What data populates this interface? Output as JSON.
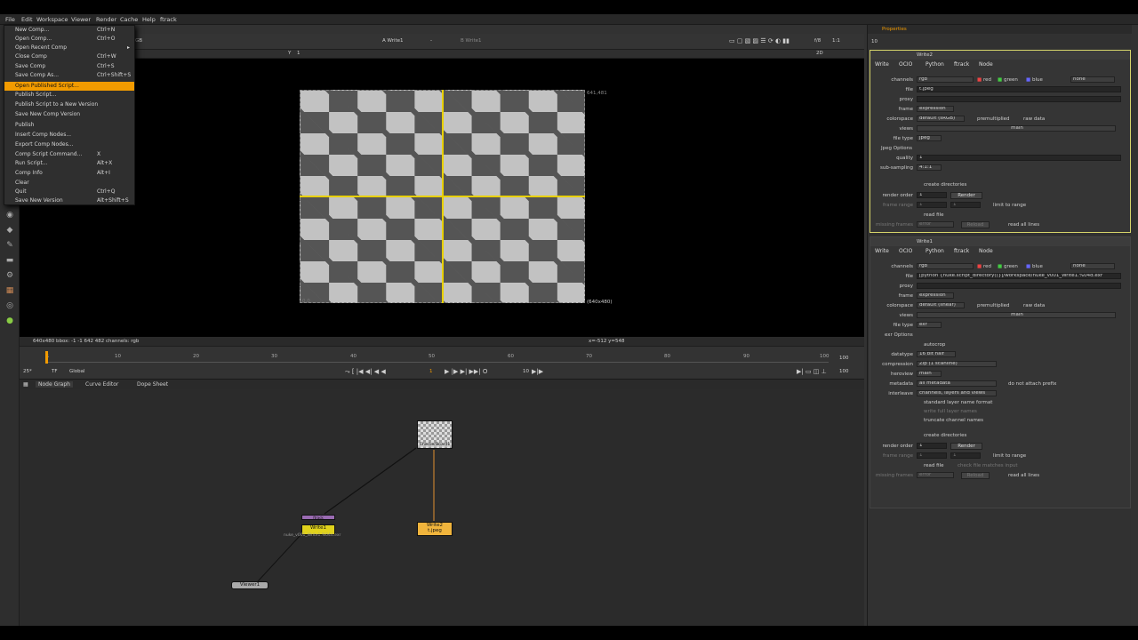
{
  "menubar": [
    "File",
    "Edit",
    "Workspace",
    "Viewer",
    "Render",
    "Cache",
    "Help",
    "ftrack"
  ],
  "file_menu": [
    {
      "label": "New Comp...",
      "shortcut": "Ctrl+N"
    },
    {
      "label": "Open Comp...",
      "shortcut": "Ctrl+O"
    },
    {
      "label": "Open Recent Comp",
      "shortcut": "▸"
    },
    {
      "label": "Close Comp",
      "shortcut": "Ctrl+W"
    },
    {
      "label": "Save Comp",
      "shortcut": "Ctrl+S"
    },
    {
      "label": "Save Comp As...",
      "shortcut": "Ctrl+Shift+S"
    },
    {
      "label": "Open Published Script...",
      "shortcut": ""
    },
    {
      "label": "Publish Script...",
      "shortcut": ""
    },
    {
      "label": "Publish Script to a New Version",
      "shortcut": ""
    },
    {
      "label": "Save New Comp Version",
      "shortcut": ""
    },
    {
      "label": "Publish",
      "shortcut": ""
    },
    {
      "label": "Insert Comp Nodes...",
      "shortcut": ""
    },
    {
      "label": "Export Comp Nodes...",
      "shortcut": ""
    },
    {
      "label": "Comp Script Command...",
      "shortcut": "X"
    },
    {
      "label": "Run Script...",
      "shortcut": "Alt+X"
    },
    {
      "label": "Comp Info",
      "shortcut": "Alt+I"
    },
    {
      "label": "Clear",
      "shortcut": ""
    },
    {
      "label": "Quit",
      "shortcut": "Ctrl+Q"
    },
    {
      "label": "Save New Version",
      "shortcut": "Alt+Shift+S"
    }
  ],
  "viewer": {
    "channel_label": "GB",
    "input_a": "A  Write1",
    "input_b": "B  Write1",
    "dash": "-",
    "view_mode": "2D",
    "zoom": "1:1",
    "gain_label": "f/8",
    "y_label": "Y",
    "y_value": "1",
    "res_top": "641,481",
    "res_bottom": "(640x480)",
    "corner_label": "0,0",
    "info_left": "640x480  bbox: -1 -1 642 482 channels: rgb",
    "info_right": "x=-512 y=548"
  },
  "timeline": {
    "ticks": [
      "1",
      "10",
      "20",
      "30",
      "40",
      "50",
      "60",
      "70",
      "80",
      "90",
      "100"
    ],
    "fps": "25*",
    "tf": "TF",
    "global": "Global",
    "frame": "1",
    "step": "10",
    "end": "100",
    "start": "1"
  },
  "panel_tabs": [
    "Node Graph",
    "Curve Editor",
    "Dope Sheet"
  ],
  "nodes": {
    "checker": "CheckerBoard1",
    "write1": "Write1",
    "write1_sub": "nuke_v001_Write1.%04d.exr",
    "write2": "Write2",
    "write2_sub": "t.jpeg",
    "viewer": "Viewer1",
    "ftrack_small": "ftrack"
  },
  "properties": {
    "header": "Properties",
    "count": "10",
    "write2": {
      "title": "Write2",
      "tabs": [
        "Write",
        "OCIO",
        "Python",
        "ftrack",
        "Node"
      ],
      "channels": "rgb",
      "red": "red",
      "green": "green",
      "blue": "blue",
      "none": "none",
      "file": "t.jpeg",
      "proxy": "",
      "frame": "expression",
      "colorspace": "default (sRGB)",
      "premultiplied": "premultiplied",
      "raw_data": "raw data",
      "views": "main",
      "file_type": "jpeg",
      "jpeg_options": "Jpeg Options",
      "quality": "1",
      "sub_sampling": "4:1:1",
      "create_dirs": "create directories",
      "render_order": "1",
      "render_btn": "Render",
      "frame_range_a": "1",
      "frame_range_b": "1",
      "limit": "limit to range",
      "read_file": "read file",
      "missing_frames": "error",
      "reload": "Reload",
      "read_all": "read all lines"
    },
    "write1": {
      "title": "Write1",
      "tabs": [
        "Write",
        "OCIO",
        "Python",
        "ftrack",
        "Node"
      ],
      "channels": "rgb",
      "red": "red",
      "green": "green",
      "blue": "blue",
      "none": "none",
      "file": "[python {nuke.script_directory()}]/workspace/nuke_v001_Write1.%04d.exr",
      "proxy": "",
      "frame": "expression",
      "colorspace": "default (linear)",
      "premultiplied": "premultiplied",
      "raw_data": "raw data",
      "views": "main",
      "file_type": "exr",
      "exr_options": "exr Options",
      "autocrop": "autocrop",
      "datatype": "16 bit half",
      "compression": "Zip (1 scanline)",
      "heroview": "main",
      "metadata": "all metadata",
      "no_prefix": "do not attach prefix",
      "interleave": "channels, layers and views",
      "std_layer": "standard layer name format",
      "write_full": "write full layer names",
      "truncate": "truncate channel names",
      "create_dirs": "create directories",
      "render_order": "1",
      "render_btn": "Render",
      "frame_range_a": "1",
      "frame_range_b": "1",
      "limit": "limit to range",
      "read_file": "read file",
      "check_file": "check file matches input",
      "missing_frames": "error",
      "reload": "Reload",
      "read_all": "read all lines"
    },
    "labels": {
      "channels": "channels",
      "file": "file",
      "proxy": "proxy",
      "frame": "frame",
      "colorspace": "colorspace",
      "views": "views",
      "file_type": "file type",
      "quality": "quality",
      "sub_sampling": "sub-sampling",
      "render_order": "render order",
      "frame_range": "frame range",
      "missing_frames": "missing frames",
      "datatype": "datatype",
      "compression": "compression",
      "heroview": "heroview",
      "metadata": "metadata",
      "interleave": "interleave"
    }
  },
  "colors": {
    "accent": "#f29b00",
    "write_node": "#e8c21a",
    "write2_node": "#f0b43c",
    "guide": "#e8d000"
  }
}
